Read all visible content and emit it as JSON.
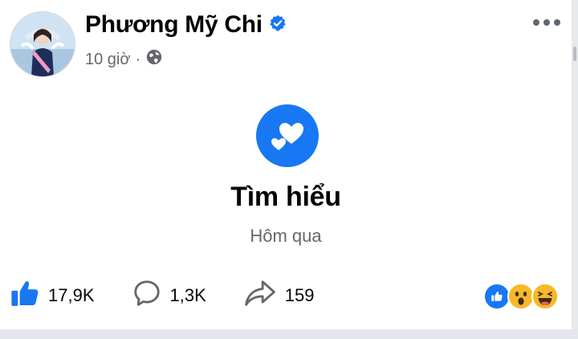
{
  "post": {
    "author": "Phương Mỹ Chi",
    "verified_icon": "verified-badge-icon",
    "time": "10 giờ",
    "separator": "·",
    "audience_icon": "globe-icon",
    "more_icon": "more-options-icon"
  },
  "life_event": {
    "icon": "hearts-icon",
    "title": "Tìm hiểu",
    "date": "Hôm qua"
  },
  "actions": {
    "like_count": "17,9K",
    "comment_count": "1,3K",
    "share_count": "159"
  },
  "reactions": [
    "like",
    "wow",
    "haha"
  ],
  "colors": {
    "accent": "#1877f2",
    "secondary_text": "#65676b"
  }
}
